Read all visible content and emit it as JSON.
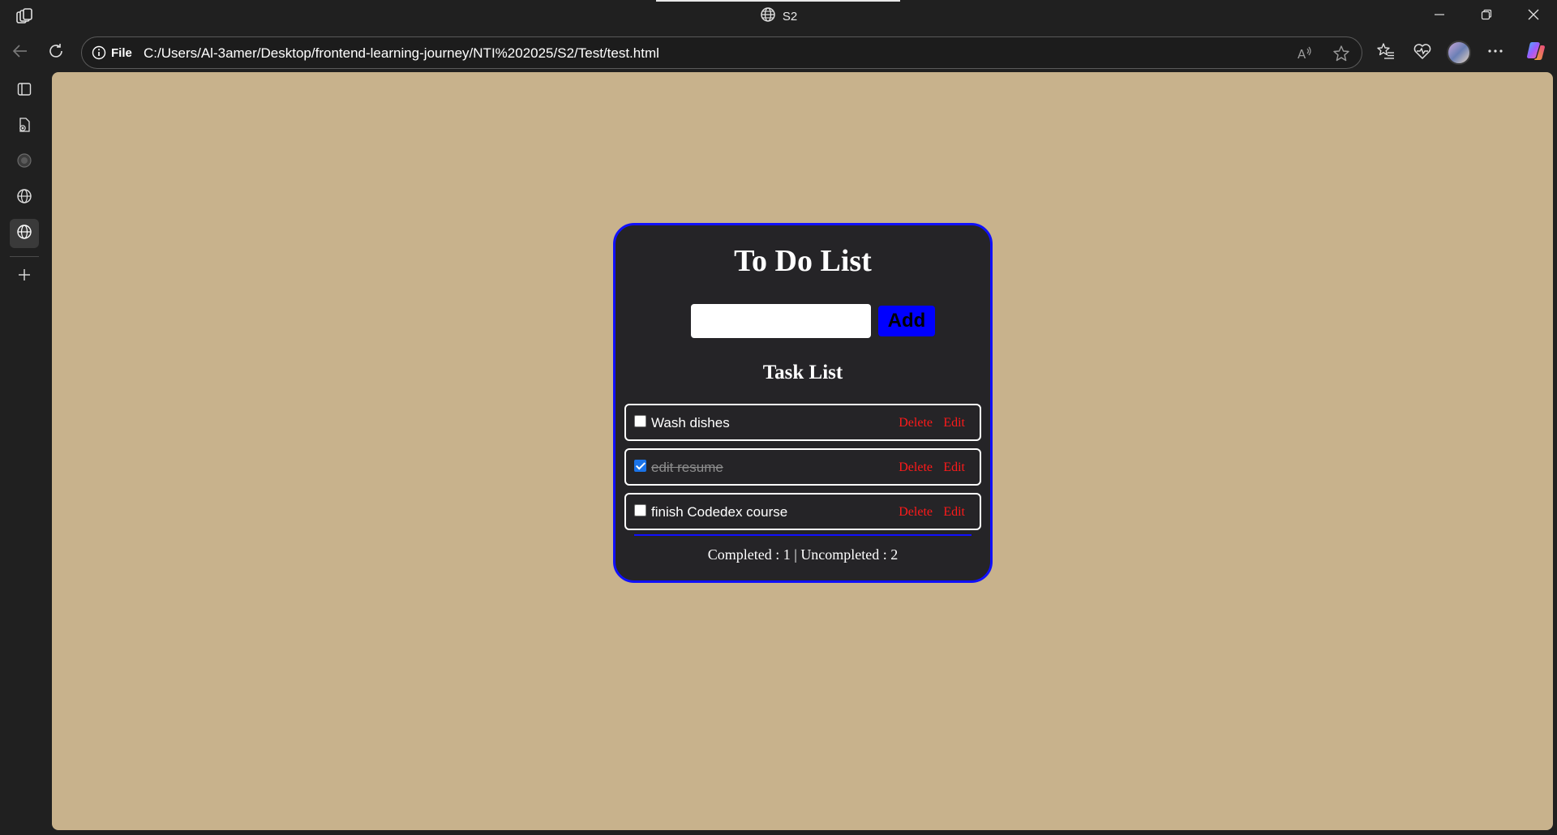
{
  "browser": {
    "tab_title": "S2",
    "omnibox": {
      "scheme_label": "File",
      "url": "C:/Users/Al-3amer/Desktop/frontend-learning-journey/NTI%202025/S2/Test/test.html"
    }
  },
  "app": {
    "title": "To Do List",
    "input": {
      "value": "",
      "placeholder": ""
    },
    "add_label": "Add",
    "list_heading": "Task List",
    "tasks": [
      {
        "text": "Wash dishes",
        "completed": false,
        "delete_label": "Delete",
        "edit_label": "Edit"
      },
      {
        "text": "edit resume",
        "completed": true,
        "delete_label": "Delete",
        "edit_label": "Edit"
      },
      {
        "text": "finish Codedex course",
        "completed": false,
        "delete_label": "Delete",
        "edit_label": "Edit"
      }
    ],
    "summary": {
      "completed_label": "Completed :",
      "completed_count": "1",
      "separator": "|",
      "uncompleted_label": "Uncompleted :",
      "uncompleted_count": "2"
    }
  },
  "colors": {
    "page_background": "#c8b28c",
    "card_background": "#252427",
    "card_border": "#1010ff",
    "add_button": "#0000ff",
    "action_link": "#ff1a1a"
  },
  "icons": {
    "titlebar": [
      "workspaces-icon",
      "globe-icon",
      "minimize-icon",
      "restore-icon",
      "close-icon"
    ],
    "toolbar": [
      "back-icon",
      "refresh-icon",
      "info-icon",
      "read-aloud-icon",
      "favorite-star-icon",
      "favorites-icon",
      "browser-essentials-icon",
      "avatar",
      "more-icon",
      "copilot-icon"
    ],
    "sidebar": [
      "tab-actions-icon",
      "page-icon",
      "tab-circle-icon",
      "globe-icon",
      "globe-icon",
      "new-tab-plus-icon"
    ]
  }
}
